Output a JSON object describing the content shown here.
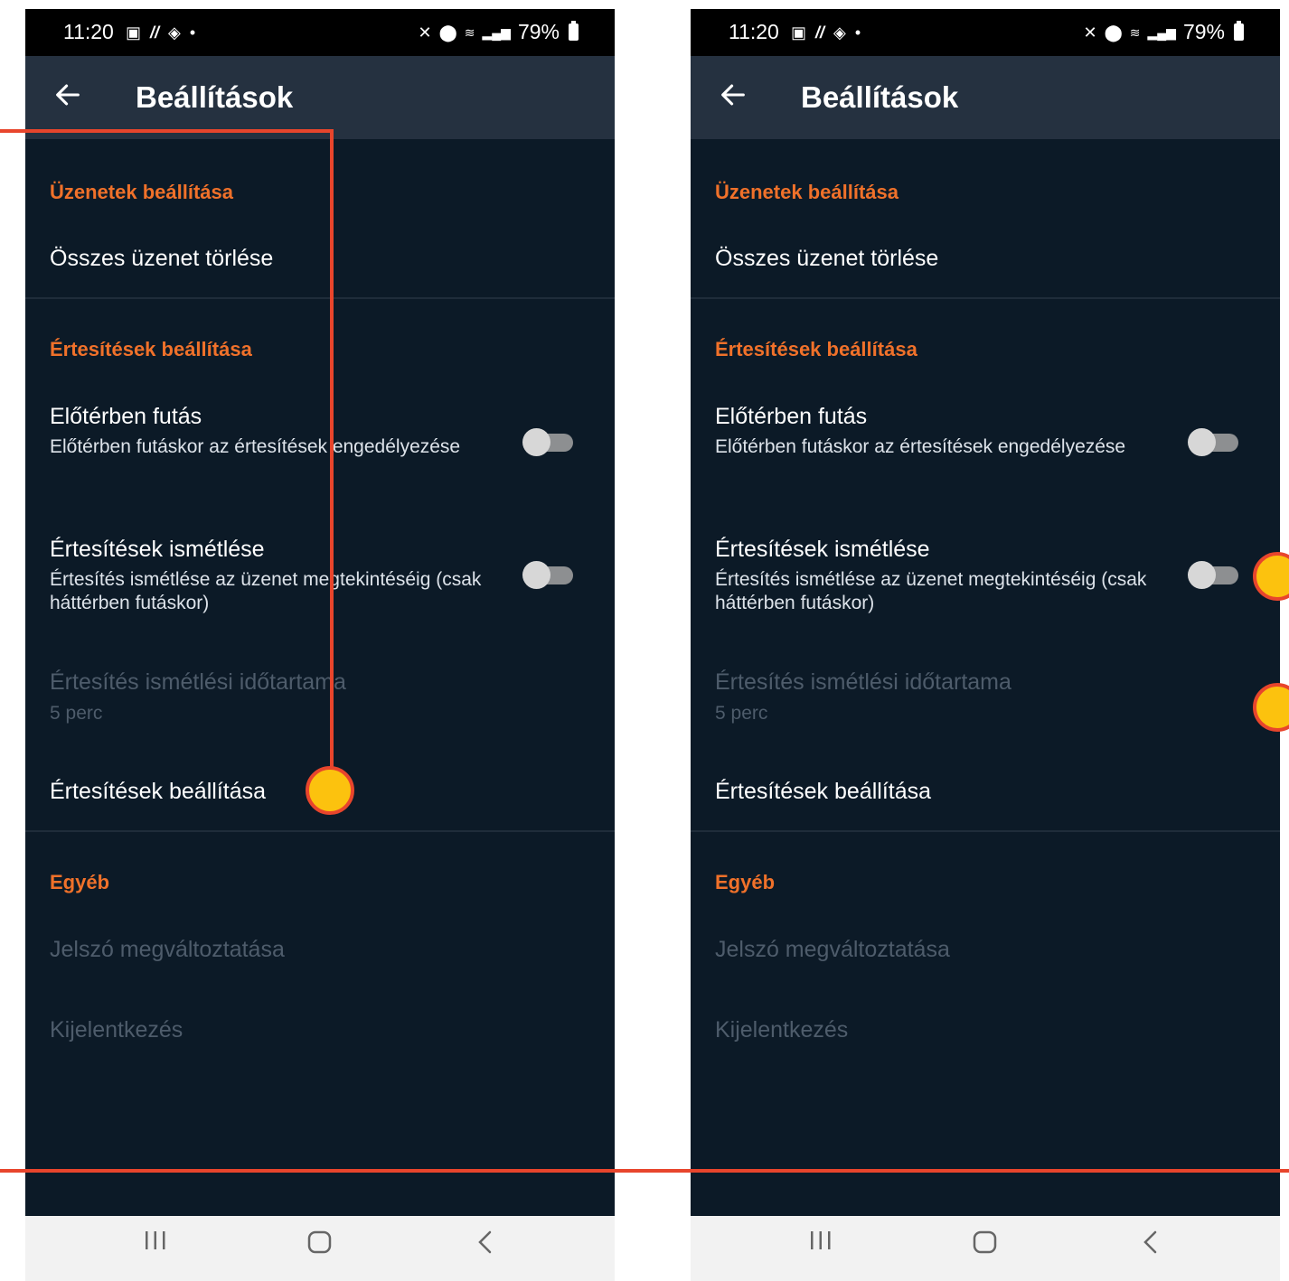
{
  "status_bar": {
    "time": "11:20",
    "battery": "79%",
    "icons_left": [
      "gallery-icon",
      "slash-icon",
      "messenger-icon",
      "dot-icon"
    ],
    "icons_right": [
      "mute-icon",
      "location-icon",
      "wifi-icon",
      "volte-signal-icon",
      "battery-icon"
    ]
  },
  "app_bar": {
    "title": "Beállítások",
    "back_icon": "arrow-left-icon"
  },
  "sections": {
    "messages": {
      "header": "Üzenetek beállítása",
      "delete_all": "Összes üzenet törlése"
    },
    "notifications": {
      "header": "Értesítések beállítása",
      "foreground": {
        "title": "Előtérben futás",
        "subtitle": "Előtérben futáskor az értesítések engedélyezése",
        "enabled": false
      },
      "repeat": {
        "title": "Értesítések ismétlése",
        "subtitle": "Értesítés ismétlése az üzenet megtekintéséig (csak háttérben futáskor)",
        "enabled": false
      },
      "repeat_duration": {
        "title": "Értesítés ismétlési időtartama",
        "value": "5 perc"
      },
      "notification_settings": "Értesítések beállítása"
    },
    "other": {
      "header": "Egyéb",
      "change_password": "Jelszó megváltoztatása",
      "logout": "Kijelentkezés"
    }
  },
  "nav_bar": {
    "recents": "|||",
    "home": "home-icon",
    "back": "back-chevron-icon"
  },
  "colors": {
    "background": "#0c1a27",
    "app_bar": "#253140",
    "accent": "#f0712a",
    "annotation_line": "#e8452c",
    "hotspot": "#fcc20e"
  }
}
